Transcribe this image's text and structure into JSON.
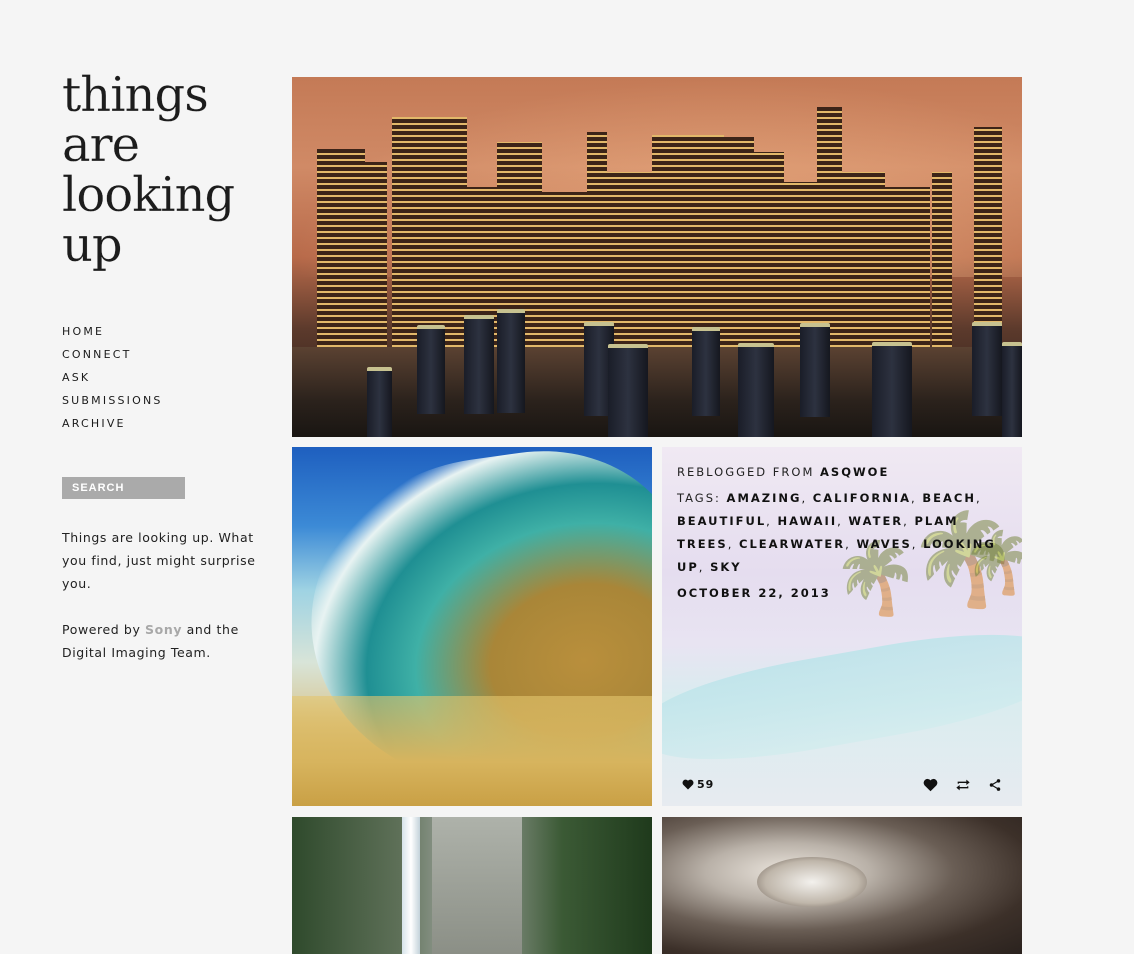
{
  "blog": {
    "title_lines": [
      "things",
      "are",
      "looking",
      "up"
    ]
  },
  "nav": {
    "items": [
      "HOME",
      "CONNECT",
      "ASK",
      "SUBMISSIONS",
      "ARCHIVE"
    ]
  },
  "search": {
    "placeholder": "SEARCH"
  },
  "description": {
    "text": "Things are looking up. What you find, just might surprise you.",
    "powered_prefix": "Powered by ",
    "powered_brand": "Sony",
    "powered_suffix": " and the Digital Imaging Team."
  },
  "post_info": {
    "reblogged_label": "REBLOGGED FROM ",
    "reblogged_from": "ASQWOE",
    "tags_label": "TAGS: ",
    "tags": [
      "AMAZING",
      "CALIFORNIA",
      "BEACH",
      "BEAUTIFUL",
      "HAWAII",
      "WATER",
      "PLAM TREES",
      "CLEARWATER",
      "WAVES",
      "LOOKING UP",
      "SKY"
    ],
    "date": "OCTOBER 22, 2013",
    "notes_count": "59"
  },
  "icons": {
    "heart": "heart-icon",
    "like": "like-icon",
    "reblog": "reblog-icon",
    "share": "share-icon"
  },
  "colors": {
    "background": "#f5f5f5",
    "search_bg": "#aaaaaa",
    "brand_link": "#a8a8a8"
  }
}
